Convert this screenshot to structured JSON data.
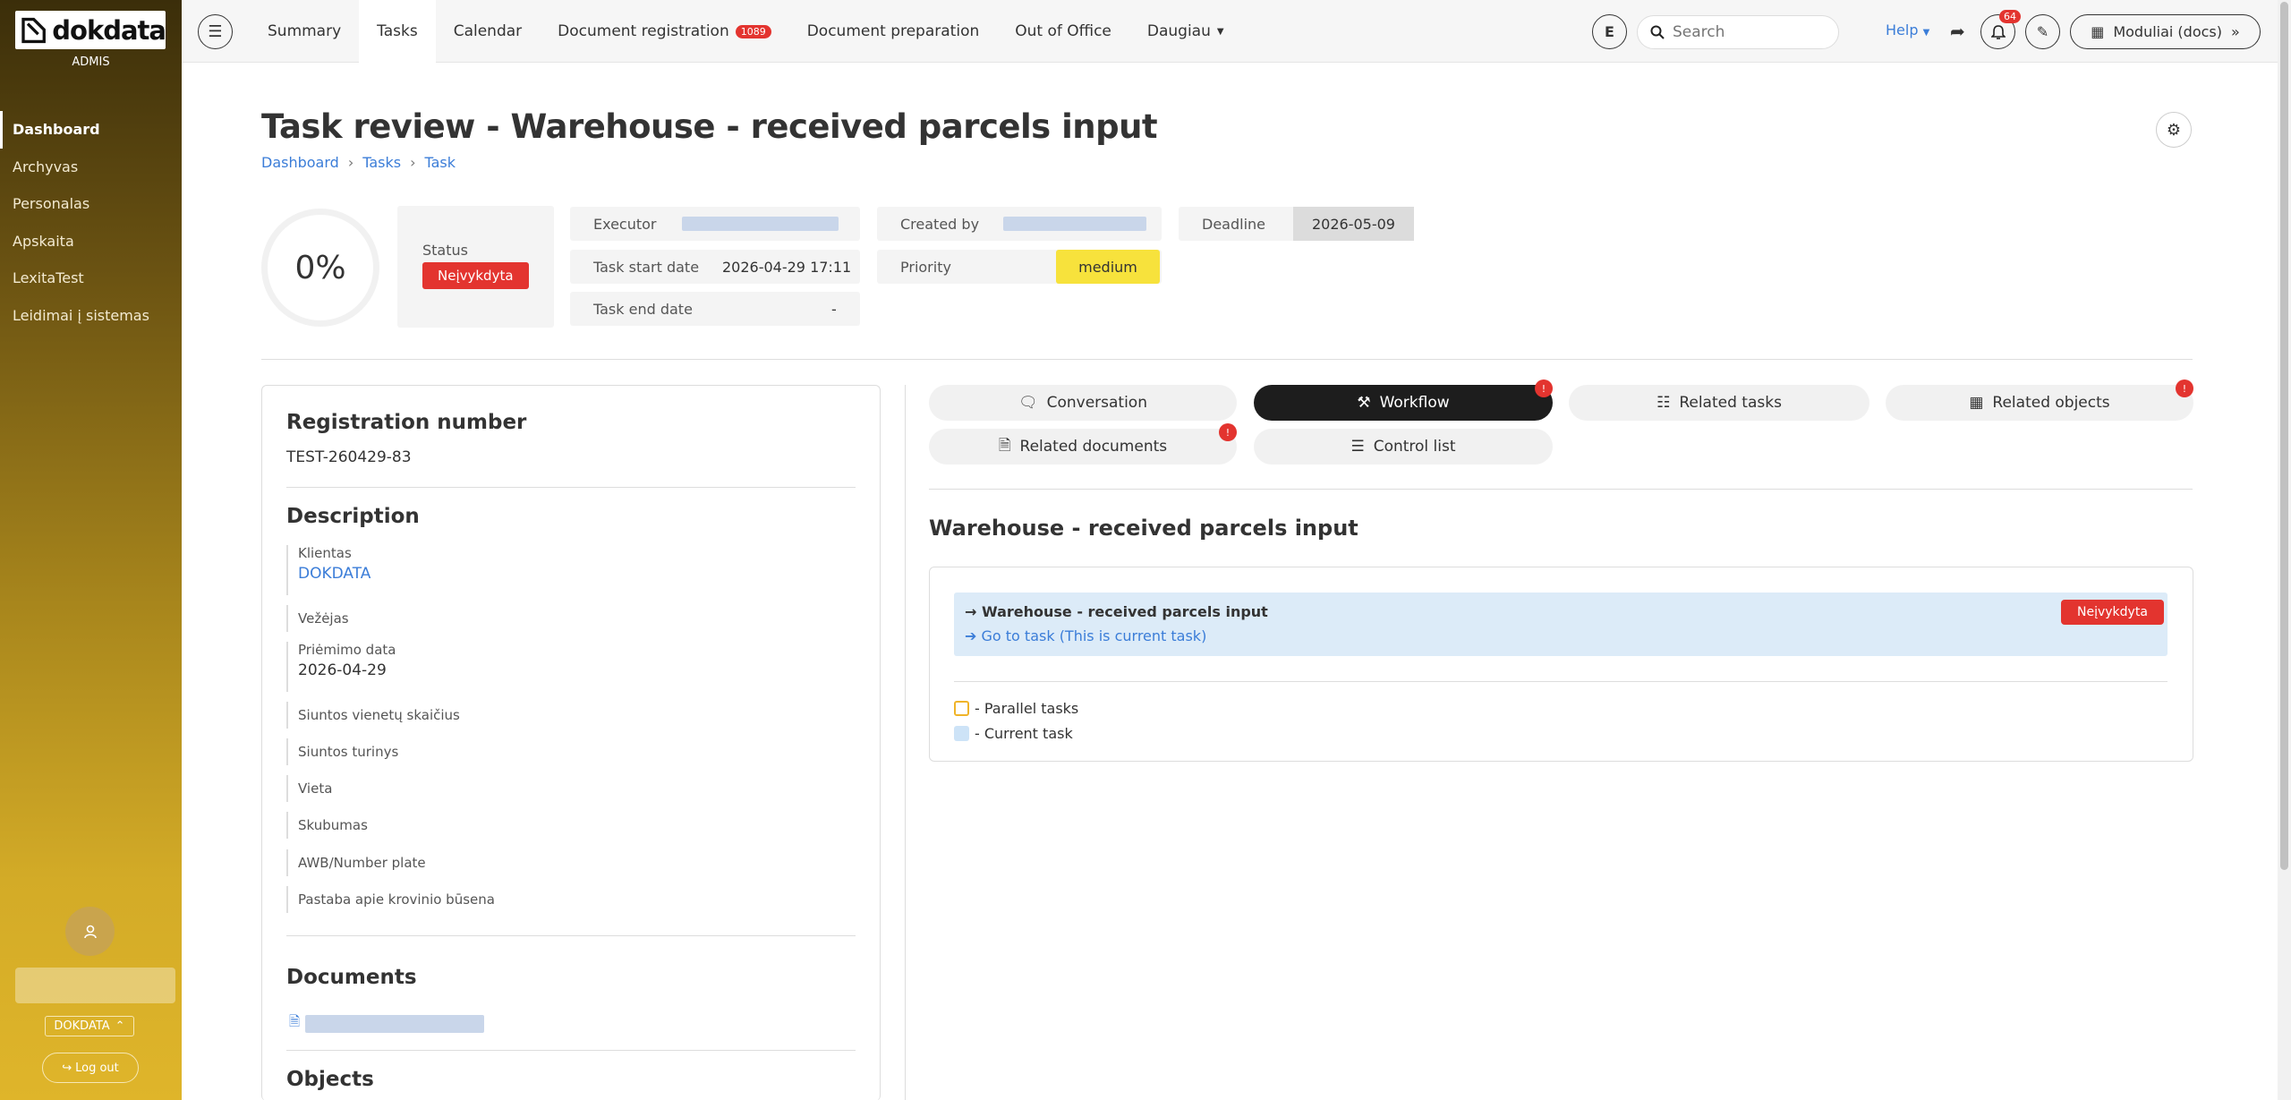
{
  "brand": {
    "name": "dokdata",
    "subtitle": "ADMIS"
  },
  "sidebar": {
    "items": [
      {
        "label": "Dashboard",
        "active": true
      },
      {
        "label": "Archyvas"
      },
      {
        "label": "Personalas"
      },
      {
        "label": "Apskaita"
      },
      {
        "label": "LexitaTest"
      },
      {
        "label": "Leidimai į sistemas"
      }
    ],
    "company": "DOKDATA",
    "logout": "Log out"
  },
  "topbar": {
    "tabs": [
      {
        "label": "Summary"
      },
      {
        "label": "Tasks",
        "active": true
      },
      {
        "label": "Calendar"
      },
      {
        "label": "Document registration",
        "badge": "1089"
      },
      {
        "label": "Document preparation"
      },
      {
        "label": "Out of Office"
      },
      {
        "label": "Daugiau"
      }
    ],
    "user_initial": "E",
    "search_placeholder": "Search",
    "help": "Help",
    "notifications": "64",
    "modules": "Moduliai (docs)"
  },
  "page": {
    "title": "Task review - Warehouse - received parcels input",
    "breadcrumb": [
      "Dashboard",
      "Tasks",
      "Task"
    ]
  },
  "summary": {
    "progress": "0%",
    "status_label": "Status",
    "status_value": "Neįvykdyta",
    "executor_label": "Executor",
    "task_start_label": "Task start date",
    "task_start_value": "2026-04-29 17:11",
    "task_end_label": "Task end date",
    "task_end_value": "-",
    "created_by_label": "Created by",
    "priority_label": "Priority",
    "priority_value": "medium",
    "deadline_label": "Deadline",
    "deadline_value": "2026-05-09"
  },
  "details": {
    "reg_title": "Registration number",
    "reg_number": "TEST-260429-83",
    "desc_title": "Description",
    "fields": [
      {
        "label": "Klientas",
        "value": "DOKDATA"
      },
      {
        "label": "Vežėjas",
        "value": ""
      },
      {
        "label": "Priėmimo data",
        "value": "2026-04-29"
      },
      {
        "label": "Siuntos vienetų skaičius",
        "value": ""
      },
      {
        "label": "Siuntos turinys",
        "value": ""
      },
      {
        "label": "Vieta",
        "value": ""
      },
      {
        "label": "Skubumas",
        "value": ""
      },
      {
        "label": "AWB/Number plate",
        "value": ""
      },
      {
        "label": "Pastaba apie krovinio būsena",
        "value": ""
      }
    ],
    "documents_title": "Documents",
    "objects_title": "Objects"
  },
  "right_tabs": [
    {
      "label": "Conversation",
      "icon": "chat-icon"
    },
    {
      "label": "Workflow",
      "icon": "hammer-icon",
      "active": true,
      "badge": "!"
    },
    {
      "label": "Related tasks",
      "icon": "sitemap-icon"
    },
    {
      "label": "Related objects",
      "icon": "objects-icon",
      "badge": "!"
    },
    {
      "label": "Related documents",
      "icon": "document-icon",
      "badge": "!"
    },
    {
      "label": "Control list",
      "icon": "list-icon"
    }
  ],
  "workflow": {
    "title": "Warehouse - received parcels input",
    "current_task": "Warehouse - received parcels input",
    "current_link": "Go to task (This is current task)",
    "current_status": "Neįvykdyta",
    "legend": [
      {
        "label": "- Parallel tasks"
      },
      {
        "label": "- Current task"
      }
    ]
  },
  "colors": {
    "accent": "#3b7dd8",
    "danger": "#e3342f",
    "priority": "#f7e23c",
    "active_tab": "#1d1d1d"
  }
}
